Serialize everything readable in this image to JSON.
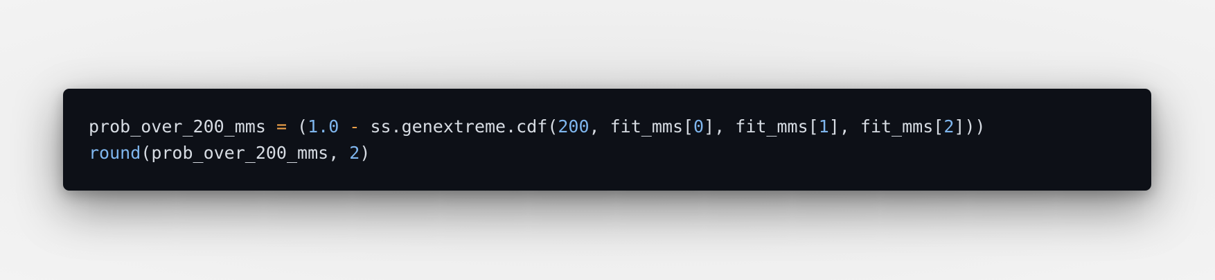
{
  "code": {
    "line1": {
      "t1": "prob_over_200_mms ",
      "t2": "=",
      "t3": " (",
      "t4": "1.0",
      "t5": " ",
      "t6": "-",
      "t7": " ss.genextreme.cdf(",
      "t8": "200",
      "t9": ", fit_mms[",
      "t10": "0",
      "t11": "], fit_mms[",
      "t12": "1",
      "t13": "], fit_mms[",
      "t14": "2",
      "t15": "]))"
    },
    "line2": {
      "t1": "round",
      "t2": "(prob_over_200_mms, ",
      "t3": "2",
      "t4": ")"
    }
  },
  "colors": {
    "background": "#0d1017",
    "text": "#d7dce3",
    "operator": "#f0a24a",
    "number": "#7fb6ee",
    "builtin": "#7fb6ee"
  }
}
